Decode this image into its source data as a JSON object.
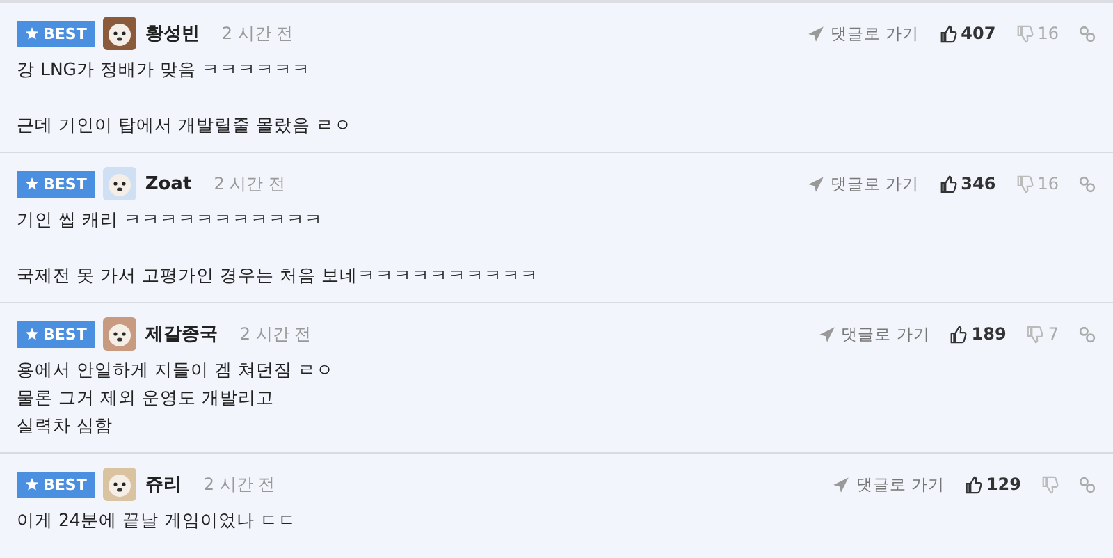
{
  "comments": [
    {
      "badge": "BEST",
      "author": "황성빈",
      "time": "2 시간 전",
      "body": "강 LNG가 정배가 맞음 ㅋㅋㅋㅋㅋㅋ\n\n근데 기인이 탑에서 개발릴줄 몰랐음 ㄹㅇ",
      "goto": "댓글로 가기",
      "likes": "407",
      "dislikes": "16"
    },
    {
      "badge": "BEST",
      "author": "Zoat",
      "time": "2 시간 전",
      "body": "기인 씹 캐리 ㅋㅋㅋㅋㅋㅋㅋㅋㅋㅋㅋ\n\n국제전 못 가서 고평가인 경우는 처음 보네ㅋㅋㅋㅋㅋㅋㅋㅋㅋㅋ",
      "goto": "댓글로 가기",
      "likes": "346",
      "dislikes": "16"
    },
    {
      "badge": "BEST",
      "author": "제갈종국",
      "time": "2 시간 전",
      "body": "용에서 안일하게 지들이 겜 쳐던짐 ㄹㅇ\n물론 그거 제외 운영도 개발리고\n실력차 심함",
      "goto": "댓글로 가기",
      "likes": "189",
      "dislikes": "7"
    },
    {
      "badge": "BEST",
      "author": "쥬리",
      "time": "2 시간 전",
      "body": "이게 24분에 끝날 게임이었나 ㄷㄷ",
      "goto": "댓글로 가기",
      "likes": "129"
    }
  ]
}
